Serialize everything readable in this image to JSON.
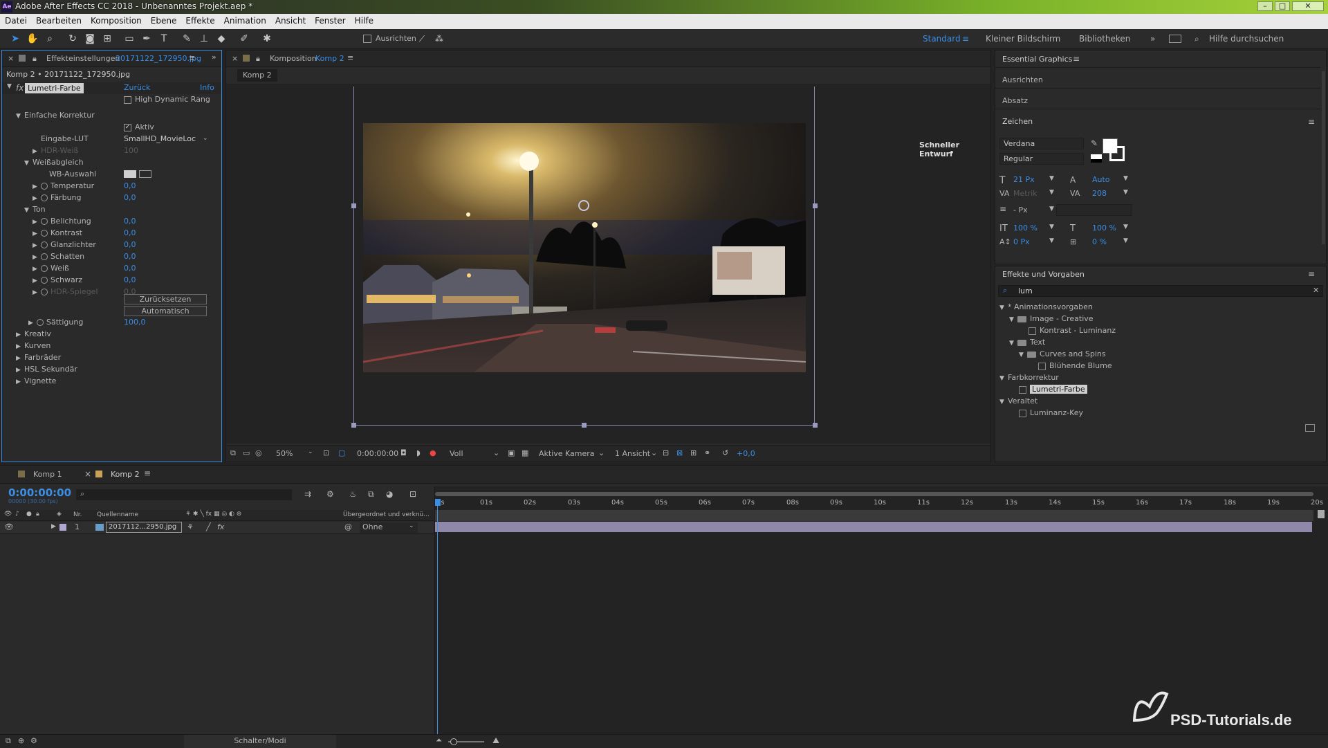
{
  "app": {
    "logo": "Ae",
    "title": "Adobe After Effects CC 2018 - Unbenanntes Projekt.aep *",
    "window_buttons": [
      "–",
      "□",
      "✕"
    ]
  },
  "menu": [
    "Datei",
    "Bearbeiten",
    "Komposition",
    "Ebene",
    "Effekte",
    "Animation",
    "Ansicht",
    "Fenster",
    "Hilfe"
  ],
  "toolbar": {
    "align_label": "Ausrichten",
    "workspaces": [
      "Standard",
      "Kleiner Bildschirm",
      "Bibliotheken"
    ],
    "search_placeholder": "Hilfe durchsuchen"
  },
  "effects_panel": {
    "tab_title": "Effekteinstellungen",
    "tab_file": "20171122_172950.jpg",
    "layer_path": "Komp 2 • 20171122_172950.jpg",
    "effect_name": "Lumetri-Farbe",
    "back_label": "Zurück",
    "info_label": "Info",
    "hdr_label": "High Dynamic Rang",
    "rows": [
      {
        "label": "Einfache Korrektur",
        "indent": 1,
        "tri": "▼"
      },
      {
        "label": "Aktiv",
        "indent": 0,
        "checkbox": true
      },
      {
        "label": "Eingabe-LUT",
        "indent": 3,
        "dropdown": "SmallHD_MovieLoc"
      },
      {
        "label": "HDR-Weiß",
        "indent": 3,
        "tri": "▶",
        "value": "100",
        "disabled": true
      },
      {
        "label": "Weißabgleich",
        "indent": 2,
        "tri": "▼"
      },
      {
        "label": "WB-Auswahl",
        "indent": 4,
        "wb": true
      },
      {
        "label": "Temperatur",
        "indent": 3,
        "tri": "▶",
        "stop": true,
        "value": "0,0"
      },
      {
        "label": "Färbung",
        "indent": 3,
        "tri": "▶",
        "stop": true,
        "value": "0,0"
      },
      {
        "label": "Ton",
        "indent": 2,
        "tri": "▼"
      },
      {
        "label": "Belichtung",
        "indent": 3,
        "tri": "▶",
        "stop": true,
        "value": "0,0"
      },
      {
        "label": "Kontrast",
        "indent": 3,
        "tri": "▶",
        "stop": true,
        "value": "0,0"
      },
      {
        "label": "Glanzlichter",
        "indent": 3,
        "tri": "▶",
        "stop": true,
        "value": "0,0"
      },
      {
        "label": "Schatten",
        "indent": 3,
        "tri": "▶",
        "stop": true,
        "value": "0,0"
      },
      {
        "label": "Weiß",
        "indent": 3,
        "tri": "▶",
        "stop": true,
        "value": "0,0"
      },
      {
        "label": "Schwarz",
        "indent": 3,
        "tri": "▶",
        "stop": true,
        "value": "0,0"
      },
      {
        "label": "HDR-Spiegel",
        "indent": 3,
        "tri": "▶",
        "stop": true,
        "value": "0,0",
        "disabled": true
      }
    ],
    "reset_label": "Zurücksetzen",
    "auto_label": "Automatisch",
    "saturation": {
      "label": "Sättigung",
      "value": "100,0"
    },
    "sections": [
      "Kreativ",
      "Kurven",
      "Farbräder",
      "HSL Sekundär",
      "Vignette"
    ]
  },
  "composition_panel": {
    "tab_title": "Komposition",
    "tab_name": "Komp 2",
    "sub_tab": "Komp 2",
    "draft_label": "Schneller Entwurf",
    "footer": {
      "zoom": "50%",
      "timecode": "0:00:00:00",
      "resolution": "Voll",
      "camera": "Aktive Kamera",
      "views": "1 Ansicht",
      "exposure": "+0,0"
    }
  },
  "essential_graphics": {
    "title": "Essential Graphics",
    "sections": [
      "Ausrichten",
      "Absatz",
      "Zeichen"
    ],
    "font": "Verdana",
    "style": "Regular",
    "font_size": "21 Px",
    "leading": "Auto",
    "kerning": "Metrik",
    "tracking": "208",
    "stroke_width": "- Px",
    "vscale": "100 %",
    "hscale": "100 %",
    "baseline": "0 Px",
    "tsume": "0 %"
  },
  "effects_presets": {
    "title": "Effekte und Vorgaben",
    "search_value": "lum",
    "tree": [
      {
        "label": "* Animationsvorgaben",
        "level": 0,
        "kind": "tri"
      },
      {
        "label": "Image - Creative",
        "level": 1,
        "kind": "folder"
      },
      {
        "label": "Kontrast - Luminanz",
        "level": 3,
        "kind": "fx"
      },
      {
        "label": "Text",
        "level": 1,
        "kind": "folder"
      },
      {
        "label": "Curves and Spins",
        "level": 2,
        "kind": "folder"
      },
      {
        "label": "Blühende Blume",
        "level": 4,
        "kind": "fx"
      },
      {
        "label": "Farbkorrektur",
        "level": 0,
        "kind": "tri"
      },
      {
        "label": "Lumetri-Farbe",
        "level": 2,
        "kind": "fx",
        "selected": true
      },
      {
        "label": "Veraltet",
        "level": 0,
        "kind": "tri"
      },
      {
        "label": "Luminanz-Key",
        "level": 2,
        "kind": "fx"
      }
    ]
  },
  "timeline": {
    "tabs": [
      "Komp 1",
      "Komp 2"
    ],
    "timecode": "0:00:00:00",
    "timecode_sub": "00000 (30.00 fps)",
    "col_nr": "Nr.",
    "col_source": "Quellenname",
    "col_parent": "Übergeordnet und verknü...",
    "layer_nr": "1",
    "layer_name": "2017112...2950.jpg",
    "parent_value": "Ohne",
    "ruler": [
      "0s",
      "01s",
      "02s",
      "03s",
      "04s",
      "05s",
      "06s",
      "07s",
      "08s",
      "09s",
      "10s",
      "11s",
      "12s",
      "13s",
      "14s",
      "15s",
      "16s",
      "17s",
      "18s",
      "19s",
      "20s"
    ],
    "footer_label": "Schalter/Modi"
  },
  "watermark": "PSD-Tutorials.de",
  "colors": {
    "accent": "#3a8ee6",
    "panel": "#2a2a2a",
    "bg": "#232323",
    "layer_bar": "#8f88a8"
  }
}
